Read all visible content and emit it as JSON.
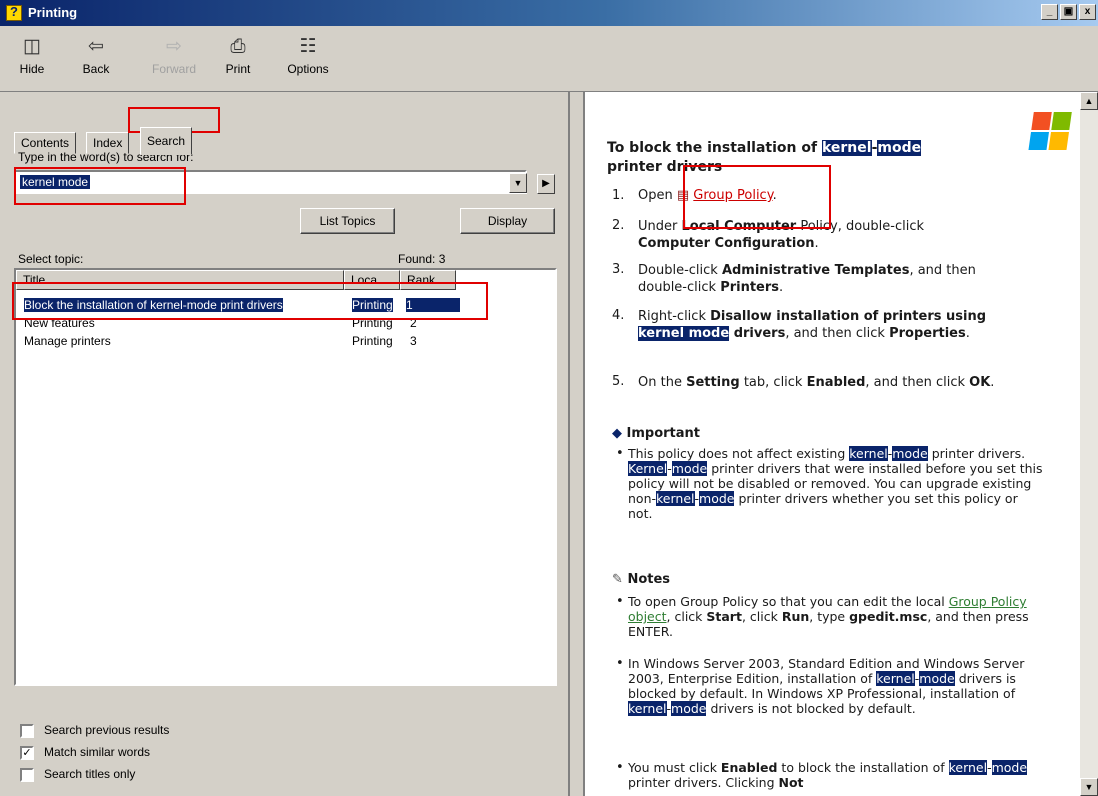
{
  "window": {
    "title": "Printing",
    "controls": [
      "_",
      "д",
      "x"
    ]
  },
  "toolbar": {
    "hide": "Hide",
    "back": "Back",
    "forward": "Forward",
    "print": "Print",
    "options": "Options"
  },
  "tabs": [
    "Contents",
    "Index",
    "Search"
  ],
  "search": {
    "prompt": "Type in the word(s) to search for:",
    "query": "kernel mode",
    "list_topics": "List Topics",
    "display": "Display",
    "select_topic": "Select topic:",
    "found": "Found: 3"
  },
  "results": {
    "columns": [
      "Title",
      "Loca...",
      "Rank"
    ],
    "rows": [
      {
        "title": "Block the installation of kernel-mode print drivers",
        "location": "Printing",
        "rank": "1"
      },
      {
        "title": "New features",
        "location": "Printing",
        "rank": "2"
      },
      {
        "title": "Manage printers",
        "location": "Printing",
        "rank": "3"
      }
    ]
  },
  "options": {
    "search_previous": "Search previous results",
    "match_similar": "Match similar words",
    "search_titles": "Search titles only"
  },
  "article": {
    "heading_1": "To block the installation of ",
    "heading_hl1": "kernel",
    "heading_hl2": "mode",
    "heading_2": "printer drivers",
    "step1_pre": "Open ",
    "step1_link": "Group Policy",
    "step2_a": "Under ",
    "step2_b": "Local Computer",
    "step2_c": " Policy, double-click",
    "step2_d": "Computer Configuration",
    "step3_a": "Double-click ",
    "step3_b": "Administrative Templates",
    "step3_c": ", and then double-click ",
    "step3_d": "Printers",
    "step4_a": "Right-click ",
    "step4_b": "Disallow installation of printers using ",
    "step4_c": "kernel mode",
    "step4_d": " drivers",
    "step4_e": ", and then click ",
    "step4_f": "Properties",
    "step5_a": "On the ",
    "step5_b": "Setting",
    "step5_c": " tab, click ",
    "step5_d": "Enabled",
    "step5_e": ", and then click ",
    "step5_f": "OK",
    "important": "Important",
    "imp_1": "This policy does not affect existing ",
    "imp_2": "printer drivers. ",
    "imp_3": "Kernel",
    "imp_4": "printer drivers that were installed before you set this policy will not be disabled or removed. You can upgrade existing non-",
    "imp_5": "printer drivers whether you set this policy or not.",
    "notes": "Notes",
    "n1_a": "To open Group Policy so that you can edit the local ",
    "n1_link": "Group Policy object",
    "n1_b": ", click ",
    "n1_c": "Start",
    "n1_d": ", click ",
    "n1_e": "Run",
    "n1_f": ", type ",
    "n1_g": "gpedit.msc",
    "n1_h": ", and then press ENTER.",
    "n2_a": "In Windows Server 2003, Standard Edition and Windows Server 2003, Enterprise Edition, installation of ",
    "n2_b": "drivers is blocked by default. In Windows XP Professional, installation of ",
    "n2_c": "drivers is not blocked by default.",
    "n3_a": "You must click ",
    "n3_b": "Enabled",
    "n3_c": " to block the installation of ",
    "n3_d": "printer drivers. Clicking ",
    "n3_e": "Not"
  }
}
